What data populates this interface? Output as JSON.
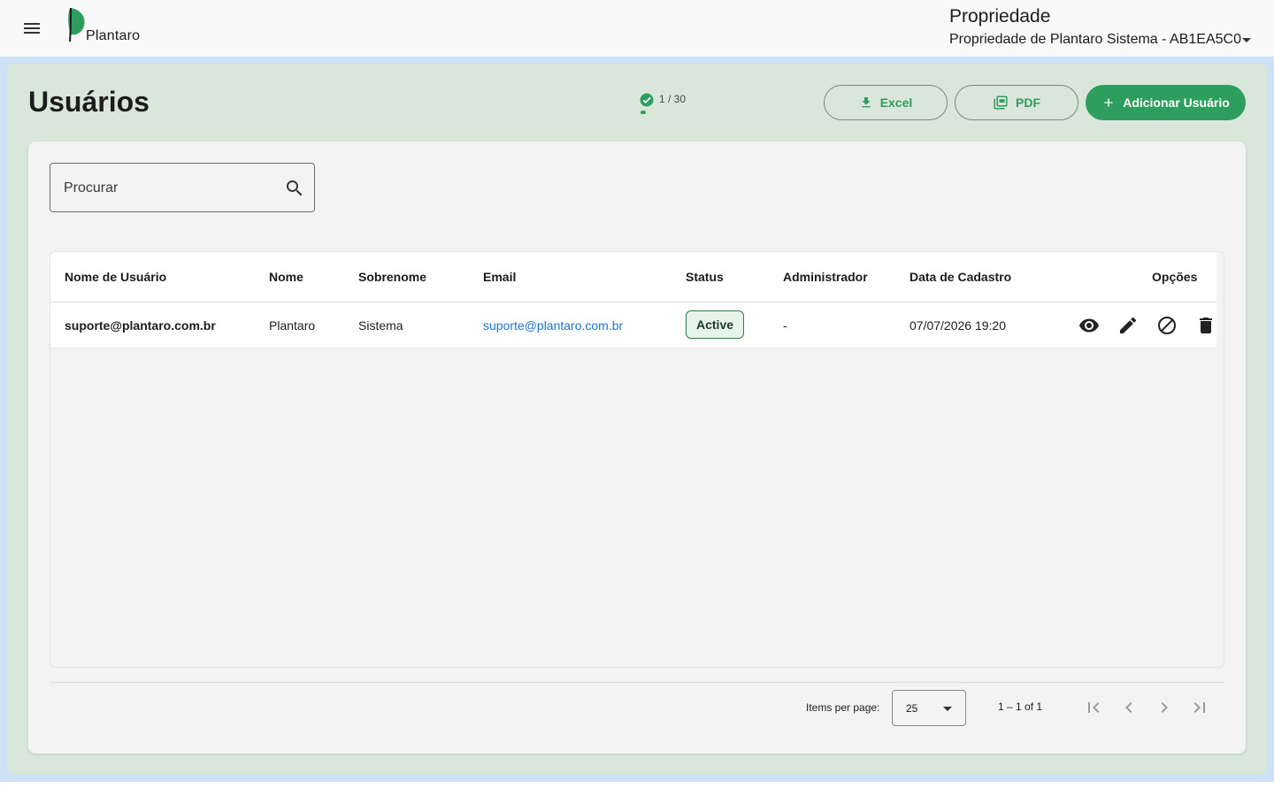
{
  "header": {
    "brand": "Plantaro",
    "property_title": "Propriedade",
    "property_selected": "Propriedade de Plantaro Sistema - AB1EA5C0"
  },
  "page": {
    "title": "Usuários",
    "quota_text": "1 / 30",
    "quota_fraction": 0.0333,
    "actions": {
      "excel_label": "Excel",
      "pdf_label": "PDF",
      "add_label": "Adicionar Usuário"
    }
  },
  "search": {
    "placeholder": "Procurar",
    "value": ""
  },
  "table": {
    "columns": [
      "Nome de Usuário",
      "Nome",
      "Sobrenome",
      "Email",
      "Status",
      "Administrador",
      "Data de Cadastro",
      "Opções"
    ],
    "rows": [
      {
        "username": "suporte@plantaro.com.br",
        "first_name": "Plantaro",
        "last_name": "Sistema",
        "email": "suporte@plantaro.com.br",
        "status": "Active",
        "admin": "-",
        "created_at": "07/07/2026 19:20"
      }
    ]
  },
  "pagination": {
    "items_per_page_label": "Items per page:",
    "items_per_page": "25",
    "range": "1 – 1 of 1"
  },
  "colors": {
    "accent": "#2e9e5e",
    "panel": "#d8e7da",
    "outer": "#cde2f7",
    "link": "#1f74c9"
  },
  "icons": [
    "menu-icon",
    "plantaro-logo",
    "dropdown-caret-icon",
    "check-circle-icon",
    "download-icon",
    "pdf-icon",
    "plus-icon",
    "search-icon",
    "eye-icon",
    "pencil-icon",
    "block-icon",
    "trash-icon",
    "first-page-icon",
    "prev-page-icon",
    "next-page-icon",
    "last-page-icon"
  ]
}
